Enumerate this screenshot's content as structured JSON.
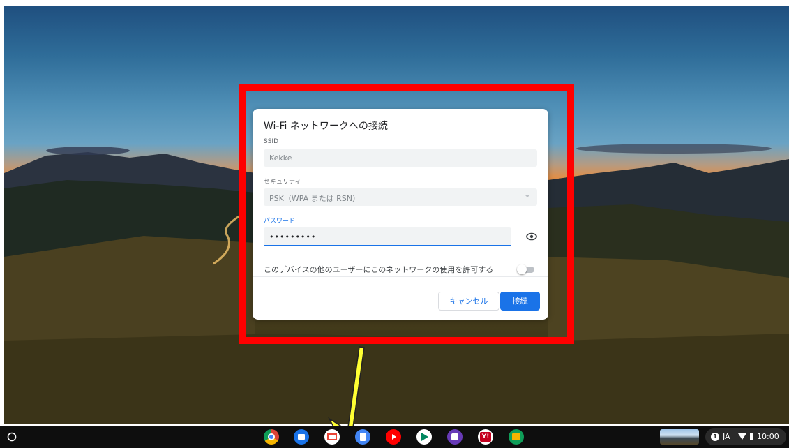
{
  "dialog": {
    "title": "Wi-Fi ネットワークへの接続",
    "ssid": {
      "label": "SSID",
      "value": "Kekke"
    },
    "security": {
      "label": "セキュリティ",
      "value": "PSK（WPA または RSN）"
    },
    "password": {
      "label": "パスワード",
      "value": "•••••••••"
    },
    "share_label": "このデバイスの他のユーザーにこのネットワークの使用を許可する",
    "share_enabled": false,
    "cancel_label": "キャンセル",
    "connect_label": "接続"
  },
  "shelf": {
    "apps": [
      "chrome-icon",
      "files-icon",
      "gmail-icon",
      "docs-icon",
      "youtube-icon",
      "play-store-icon",
      "tasks-icon",
      "yahoo-icon",
      "classroom-icon"
    ],
    "status": {
      "notifications": "1",
      "ime": "JA",
      "time": "10:00"
    }
  },
  "colors": {
    "accent": "#1a73e8",
    "highlight": "#ff0000",
    "arrow": "#ffff33"
  }
}
